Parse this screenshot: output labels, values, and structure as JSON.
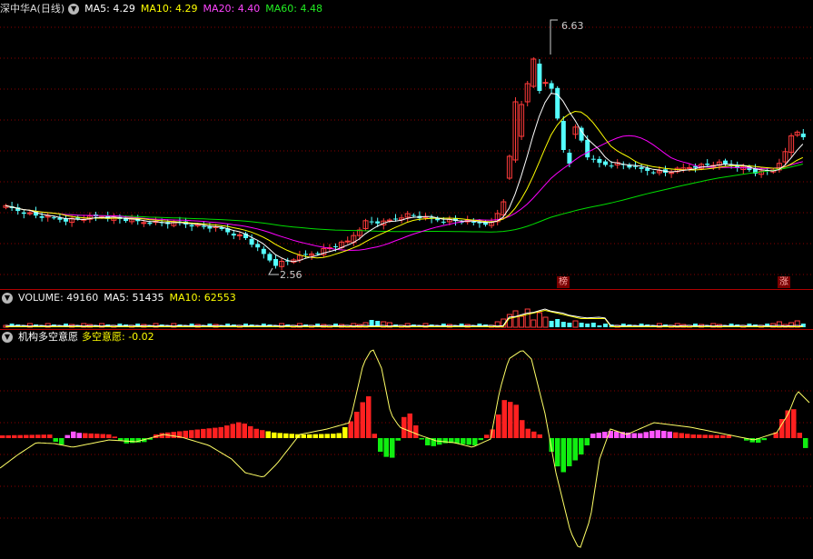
{
  "main_panel": {
    "stock_title": "深中华A(日线)",
    "ma5": "MA5: 4.29",
    "ma10": "MA10: 4.29",
    "ma20": "MA20: 4.40",
    "ma60": "MA60: 4.48",
    "high_label": "6.63",
    "low_label": "2.56",
    "badge_bang": "榜",
    "badge_zhang": "涨"
  },
  "volume_panel": {
    "volume": "VOLUME: 49160",
    "ma5": "MA5: 51435",
    "ma10": "MA10: 62553"
  },
  "indicator_panel": {
    "name": "机构多空意愿",
    "value": "多空意愿: -0.02"
  },
  "colors": {
    "up": "#ff3b3b",
    "down": "#54ffff",
    "ma5": "#ffffff",
    "ma10": "#ffff00",
    "ma20": "#ff00ff",
    "ma60": "#00dd00",
    "grid": "#8a0000",
    "hist_up": "#ff2020",
    "hist_down": "#11ee11",
    "hist_pink": "#ff55ff",
    "hist_yellow": "#ffff00",
    "osc_line": "#ffff66"
  },
  "chart_data": [
    {
      "type": "candlestick",
      "title": "深中华A(日线)",
      "y_min": 2.56,
      "y_max": 6.63,
      "series": [
        {
          "name": "MA5",
          "last": 4.29
        },
        {
          "name": "MA10",
          "last": 4.29
        },
        {
          "name": "MA20",
          "last": 4.4
        },
        {
          "name": "MA60",
          "last": 4.48
        }
      ]
    },
    {
      "type": "bar",
      "title": "VOLUME",
      "series": [
        {
          "name": "VOLUME",
          "last": 49160
        },
        {
          "name": "MA5",
          "last": 51435
        },
        {
          "name": "MA10",
          "last": 62553
        }
      ]
    },
    {
      "type": "bar",
      "title": "机构多空意愿",
      "series": [
        {
          "name": "多空意愿",
          "last": -0.02
        }
      ]
    }
  ]
}
